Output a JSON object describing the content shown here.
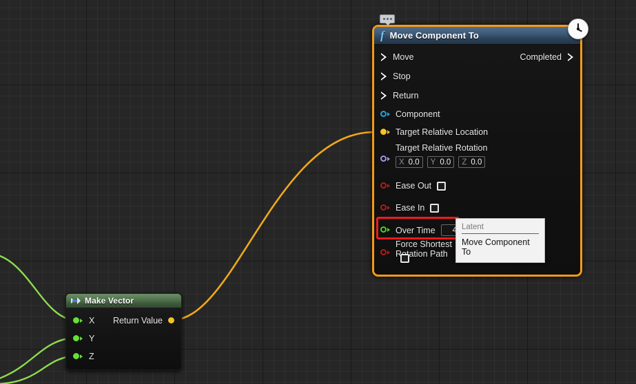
{
  "canvas": {
    "grid_minor_color": "#2b2b2b",
    "grid_major_color": "#151515",
    "background_color": "#262626"
  },
  "nodes": {
    "move_component_to": {
      "title": "Move Component To",
      "icon": "function-f-icon",
      "selected": true,
      "selection_color": "#f59b17",
      "header_color": "#3d5a78",
      "badge": {
        "name": "latent-clock-icon",
        "tooltip": "Latent"
      },
      "comment_bubble": "comment-bubble-icon",
      "exec_inputs": [
        {
          "label": "Move"
        },
        {
          "label": "Stop"
        },
        {
          "label": "Return"
        }
      ],
      "exec_outputs": [
        {
          "label": "Completed"
        }
      ],
      "data_inputs": [
        {
          "label": "Component",
          "pin_color": "#1ba7e8",
          "filled": false
        },
        {
          "label": "Target Relative Location",
          "pin_color": "#f6c325",
          "filled": true
        },
        {
          "label": "Target Relative Rotation",
          "pin_color": "#9a9ae8",
          "filled": false
        },
        {
          "label": "Ease Out",
          "pin_color": "#b81919",
          "filled": false
        },
        {
          "label": "Ease In",
          "pin_color": "#b81919",
          "filled": false
        },
        {
          "label": "Over Time",
          "pin_color": "#4cd321",
          "filled": false
        },
        {
          "label": "Force Shortest Rotation Path",
          "pin_color": "#b81919",
          "filled": false
        }
      ],
      "rotation_fields": [
        {
          "axis": "X",
          "value": "0.0"
        },
        {
          "axis": "Y",
          "value": "0.0"
        },
        {
          "axis": "Z",
          "value": "0.0"
        }
      ],
      "over_time_value": "4.0",
      "ease_out_checked": false,
      "ease_in_checked": false,
      "force_shortest_checked": false
    },
    "make_vector": {
      "title": "Make Vector",
      "icon": "compact-node-icon",
      "header_color": "#53744f",
      "inputs": [
        {
          "label": "X",
          "pin_color": "#66e038"
        },
        {
          "label": "Y",
          "pin_color": "#66e038"
        },
        {
          "label": "Z",
          "pin_color": "#66e038"
        }
      ],
      "outputs": [
        {
          "label": "Return Value",
          "pin_color": "#f6c325"
        }
      ]
    }
  },
  "highlight": {
    "target": "Over Time",
    "color": "#ee1b1b"
  },
  "tooltip": {
    "category": "Latent",
    "title": "Move Component To",
    "background": "#f2f2f2"
  },
  "wires": {
    "vector_to_location_color": "#f0a81c",
    "input_wire_color": "#8ddc4e"
  }
}
